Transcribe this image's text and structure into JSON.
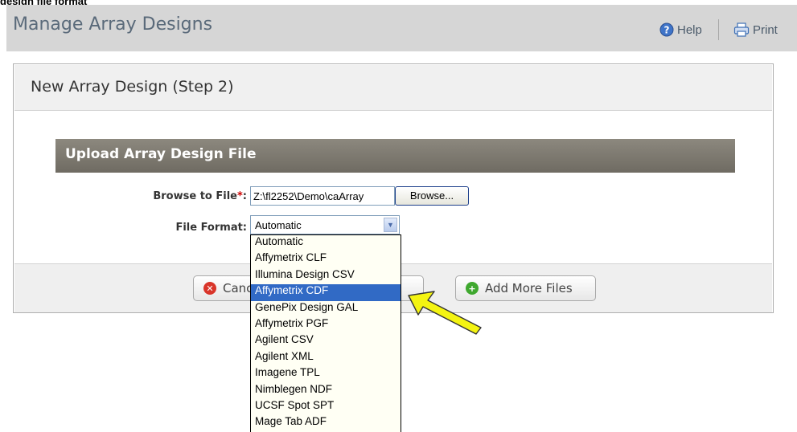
{
  "caption": "design file format",
  "topbar": {
    "title": "Manage Array Designs",
    "help": "Help",
    "print": "Print"
  },
  "panel": {
    "title": "New Array Design (Step 2)"
  },
  "section": {
    "title": "Upload Array Design File"
  },
  "form": {
    "file_label": "Browse to File",
    "required_mark": "*",
    "file_label_colon": ":",
    "file_value": "Z:\\fl2252\\Demo\\caArray",
    "browse": "Browse...",
    "format_label": "File Format:",
    "format_selected": "Automatic"
  },
  "footer": {
    "cancel": "Cancel",
    "add_more": "Add More Files"
  },
  "dropdown": {
    "options": [
      "Automatic",
      "Affymetrix CLF",
      "Illumina Design CSV",
      "Affymetrix CDF",
      "GenePix Design GAL",
      "Affymetrix PGF",
      "Agilent CSV",
      "Agilent XML",
      "Imagene TPL",
      "Nimblegen NDF",
      "UCSF Spot SPT",
      "Mage Tab ADF"
    ],
    "highlighted": "Affymetrix CDF"
  },
  "colors": {
    "arrow": "#f4f411",
    "cancel_icon": "#d9352a",
    "add_icon": "#3fa82f",
    "section_header": "#7d796f"
  },
  "icons": {
    "help": "help-icon",
    "print": "printer-icon",
    "cancel": "cancel-icon",
    "add": "add-icon",
    "callout": "arrow-icon"
  }
}
